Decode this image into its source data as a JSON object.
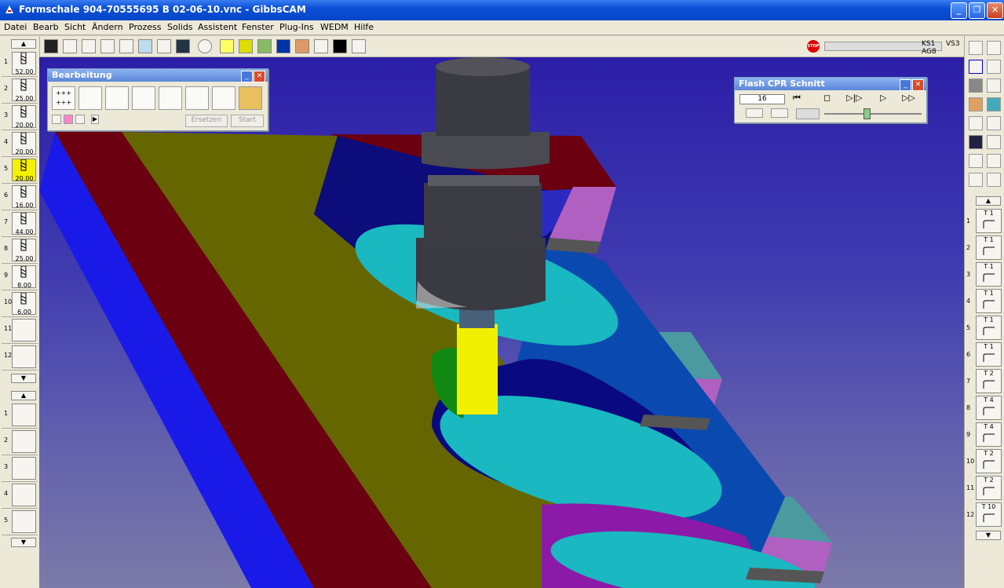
{
  "window": {
    "title": "Formschale 904-70555695 B 02-06-10.vnc - GibbsCAM",
    "min": "_",
    "max": "❐",
    "close": "✕"
  },
  "menu": [
    "Datei",
    "Bearb",
    "Sicht",
    "Ändern",
    "Prozess",
    "Solids",
    "Assistent",
    "Fenster",
    "Plug-Ins",
    "WEDM",
    "Hilfe"
  ],
  "status": {
    "ks": "KS1",
    "ag": "AG8",
    "vs": "VS3",
    "stop": "STOP"
  },
  "tools": [
    {
      "num": "1",
      "value": "52.00"
    },
    {
      "num": "2",
      "value": "25.00"
    },
    {
      "num": "3",
      "value": "20.00"
    },
    {
      "num": "4",
      "value": "20.00"
    },
    {
      "num": "5",
      "value": "20.00",
      "selected": true
    },
    {
      "num": "6",
      "value": "16.00"
    },
    {
      "num": "7",
      "value": "44.00"
    },
    {
      "num": "8",
      "value": "25.00"
    },
    {
      "num": "9",
      "value": "8.00"
    },
    {
      "num": "10",
      "value": "6.00"
    },
    {
      "num": "11",
      "value": ""
    },
    {
      "num": "12",
      "value": ""
    }
  ],
  "lower_slots": [
    "1",
    "2",
    "3",
    "4",
    "5"
  ],
  "operations": [
    {
      "num": "1",
      "tool": "T 1"
    },
    {
      "num": "2",
      "tool": "T 1"
    },
    {
      "num": "3",
      "tool": "T 1"
    },
    {
      "num": "4",
      "tool": "T 1"
    },
    {
      "num": "5",
      "tool": "T 1"
    },
    {
      "num": "6",
      "tool": "T 1"
    },
    {
      "num": "7",
      "tool": "T 2"
    },
    {
      "num": "8",
      "tool": "T 4"
    },
    {
      "num": "9",
      "tool": "T 4"
    },
    {
      "num": "10",
      "tool": "T 2"
    },
    {
      "num": "11",
      "tool": "T 2"
    },
    {
      "num": "12",
      "tool": "T 10"
    }
  ],
  "bearbeitung": {
    "title": "Bearbeitung",
    "replace": "Ersetzen",
    "start": "Start",
    "points": "+++ +++"
  },
  "flash": {
    "title": "Flash CPR Schnitt",
    "value": "16",
    "slider_value": 0.4
  },
  "colors": {
    "titlebar": "#0a4fd8",
    "panel": "#ece9d8",
    "viewport_top": "#2c1ea8",
    "viewport_bottom": "#7c7aa8",
    "tool_yellow": "#f5f000"
  }
}
